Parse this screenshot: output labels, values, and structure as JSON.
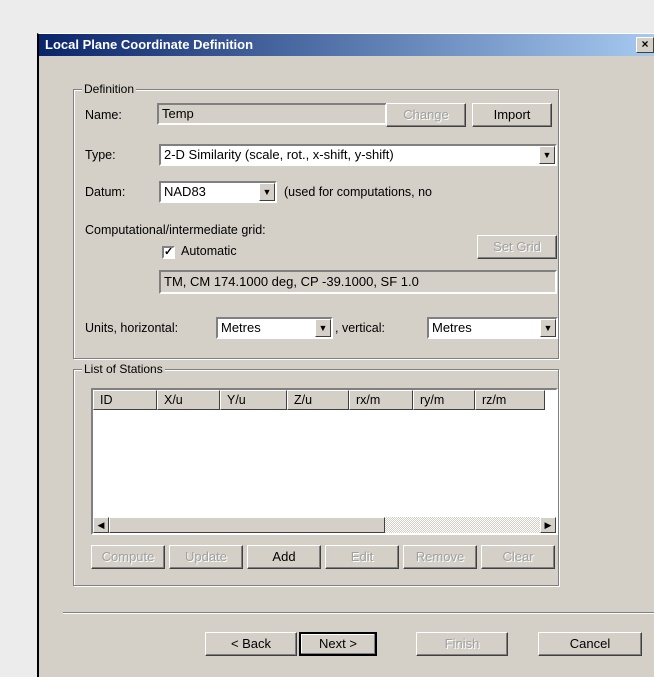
{
  "window": {
    "title": "Local Plane Coordinate Definition",
    "close_glyph": "×"
  },
  "definition": {
    "legend": "Definition",
    "name_label": "Name:",
    "name_value": "Temp",
    "change_label": "Change",
    "import_label": "Import",
    "type_label": "Type:",
    "type_value": "2-D Similarity (scale, rot., x-shift, y-shift)",
    "datum_label": "Datum:",
    "datum_value": "NAD83",
    "datum_note": "(used for computations, no",
    "grid_label": "Computational/intermediate grid:",
    "automatic_label": "Automatic",
    "automatic_checked": true,
    "set_grid_label": "Set Grid",
    "grid_info": "TM, CM 174.1000 deg, CP -39.1000, SF 1.0",
    "units_h_label": "Units, horizontal:",
    "units_h_value": "Metres",
    "units_v_label": ",  vertical:",
    "units_v_value": "Metres"
  },
  "stations": {
    "legend": "List of Stations",
    "columns": [
      "ID",
      "X/u",
      "Y/u",
      "Z/u",
      "rx/m",
      "ry/m",
      "rz/m"
    ],
    "rows": [],
    "compute_label": "Compute",
    "update_label": "Update",
    "add_label": "Add",
    "edit_label": "Edit",
    "remove_label": "Remove",
    "clear_label": "Clear"
  },
  "footer": {
    "back_label": "< Back",
    "next_label": "Next >",
    "finish_label": "Finish",
    "cancel_label": "Cancel"
  },
  "colors": {
    "dialog_bg": "#d4d0c8",
    "title_start": "#0a246a",
    "title_end": "#a6caf0",
    "disabled_text": "#a0a0a0"
  }
}
